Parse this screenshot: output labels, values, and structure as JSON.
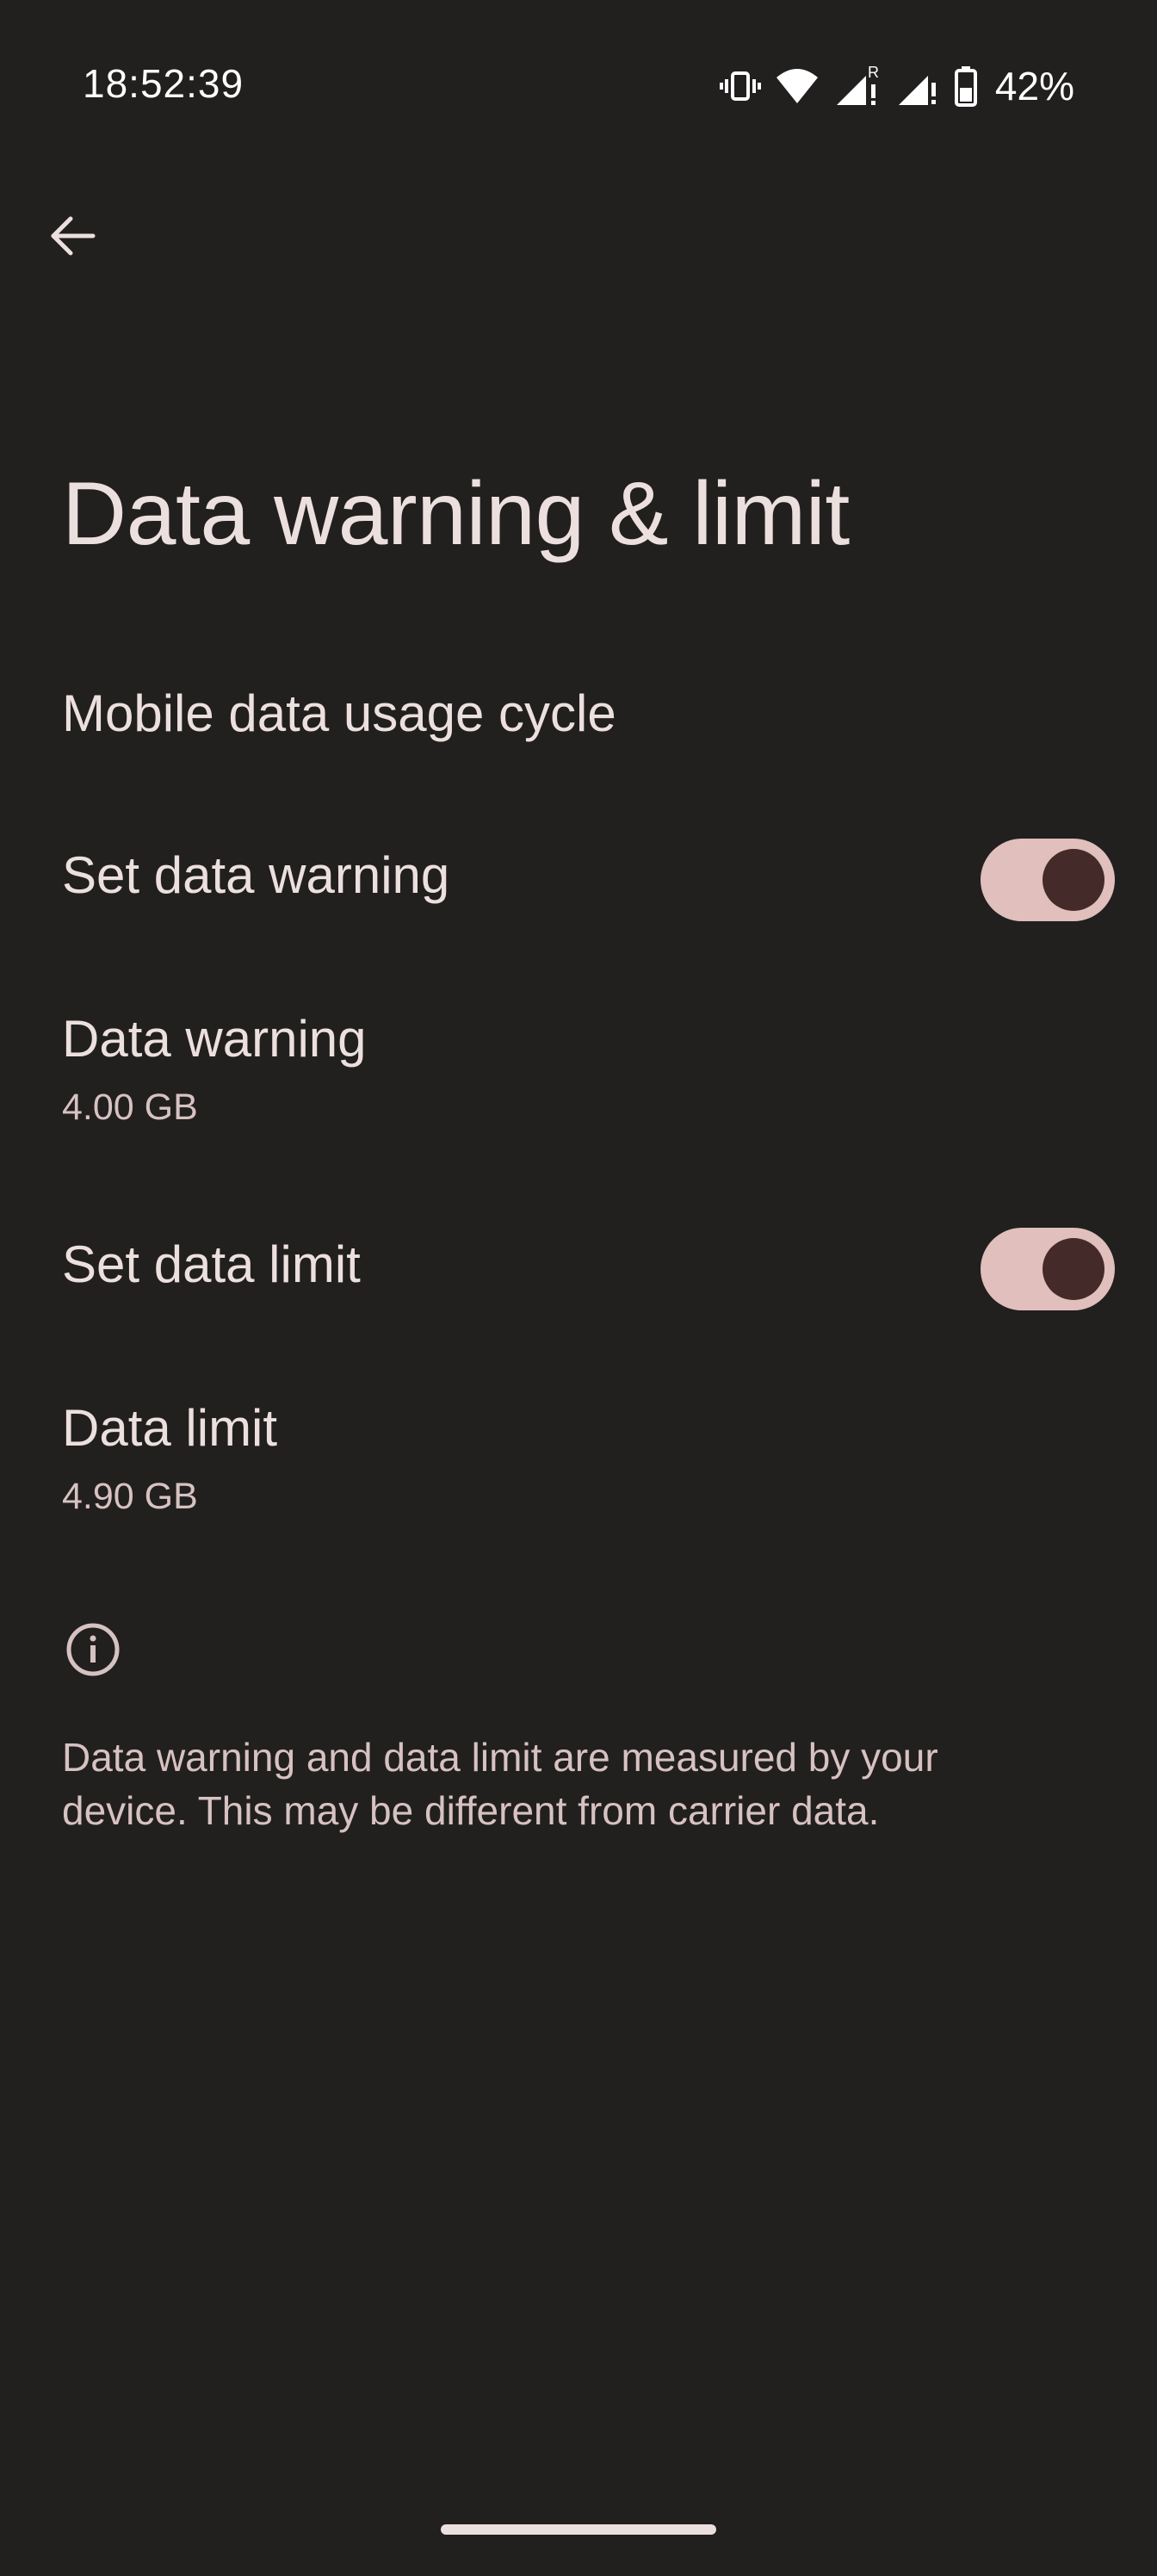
{
  "status_bar": {
    "time": "18:52:39",
    "battery_percent": "42%",
    "icons": [
      "vibrate-icon",
      "wifi-icon",
      "signal-roaming-icon",
      "signal-icon",
      "battery-icon"
    ],
    "roaming_label": "R"
  },
  "header": {
    "back_icon": "arrow-back-icon",
    "title": "Data warning & limit"
  },
  "items": [
    {
      "title": "Mobile data usage cycle"
    },
    {
      "title": "Set data warning",
      "toggle_on": true
    },
    {
      "title": "Data warning",
      "summary": "4.00 GB"
    },
    {
      "title": "Set data limit",
      "toggle_on": true
    },
    {
      "title": "Data limit",
      "summary": "4.90 GB"
    }
  ],
  "footer": {
    "icon": "info-icon",
    "text": "Data warning and data limit are measured by your device. This may be different from carrier data."
  },
  "colors": {
    "background": "#221f1f",
    "text_primary": "#ece0df",
    "text_secondary": "#d6c2c1",
    "toggle_track": "#e0bfbc",
    "toggle_thumb": "#442a28"
  }
}
